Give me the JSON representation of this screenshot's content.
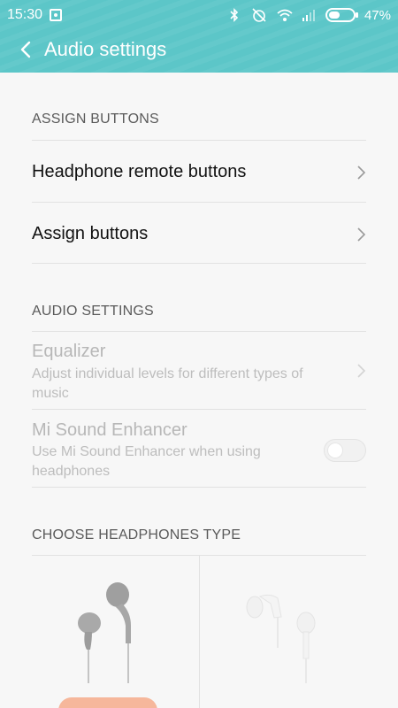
{
  "status": {
    "time": "15:30",
    "battery": "47%",
    "battery_level": 0.47
  },
  "header": {
    "title": "Audio settings"
  },
  "sections": {
    "assign": {
      "header": "ASSIGN BUTTONS",
      "items": [
        {
          "label": "Headphone remote buttons"
        },
        {
          "label": "Assign buttons"
        }
      ]
    },
    "audio": {
      "header": "AUDIO SETTINGS",
      "equalizer": {
        "title": "Equalizer",
        "subtitle": "Adjust individual levels for different types of music"
      },
      "enhancer": {
        "title": "Mi Sound Enhancer",
        "subtitle": "Use Mi Sound Enhancer when using headphones",
        "enabled": false
      }
    },
    "headphones": {
      "header": "CHOOSE HEADPHONES TYPE"
    }
  },
  "icons": {
    "back": "chevron-left-icon",
    "chevron": "chevron-right-icon",
    "bluetooth": "bluetooth-icon",
    "alarm": "alarm-off-icon",
    "wifi": "wifi-icon",
    "signal": "signal-icon",
    "battery": "battery-icon"
  },
  "colors": {
    "accent": "#5cc6c8",
    "pill": "#f6b79b"
  }
}
